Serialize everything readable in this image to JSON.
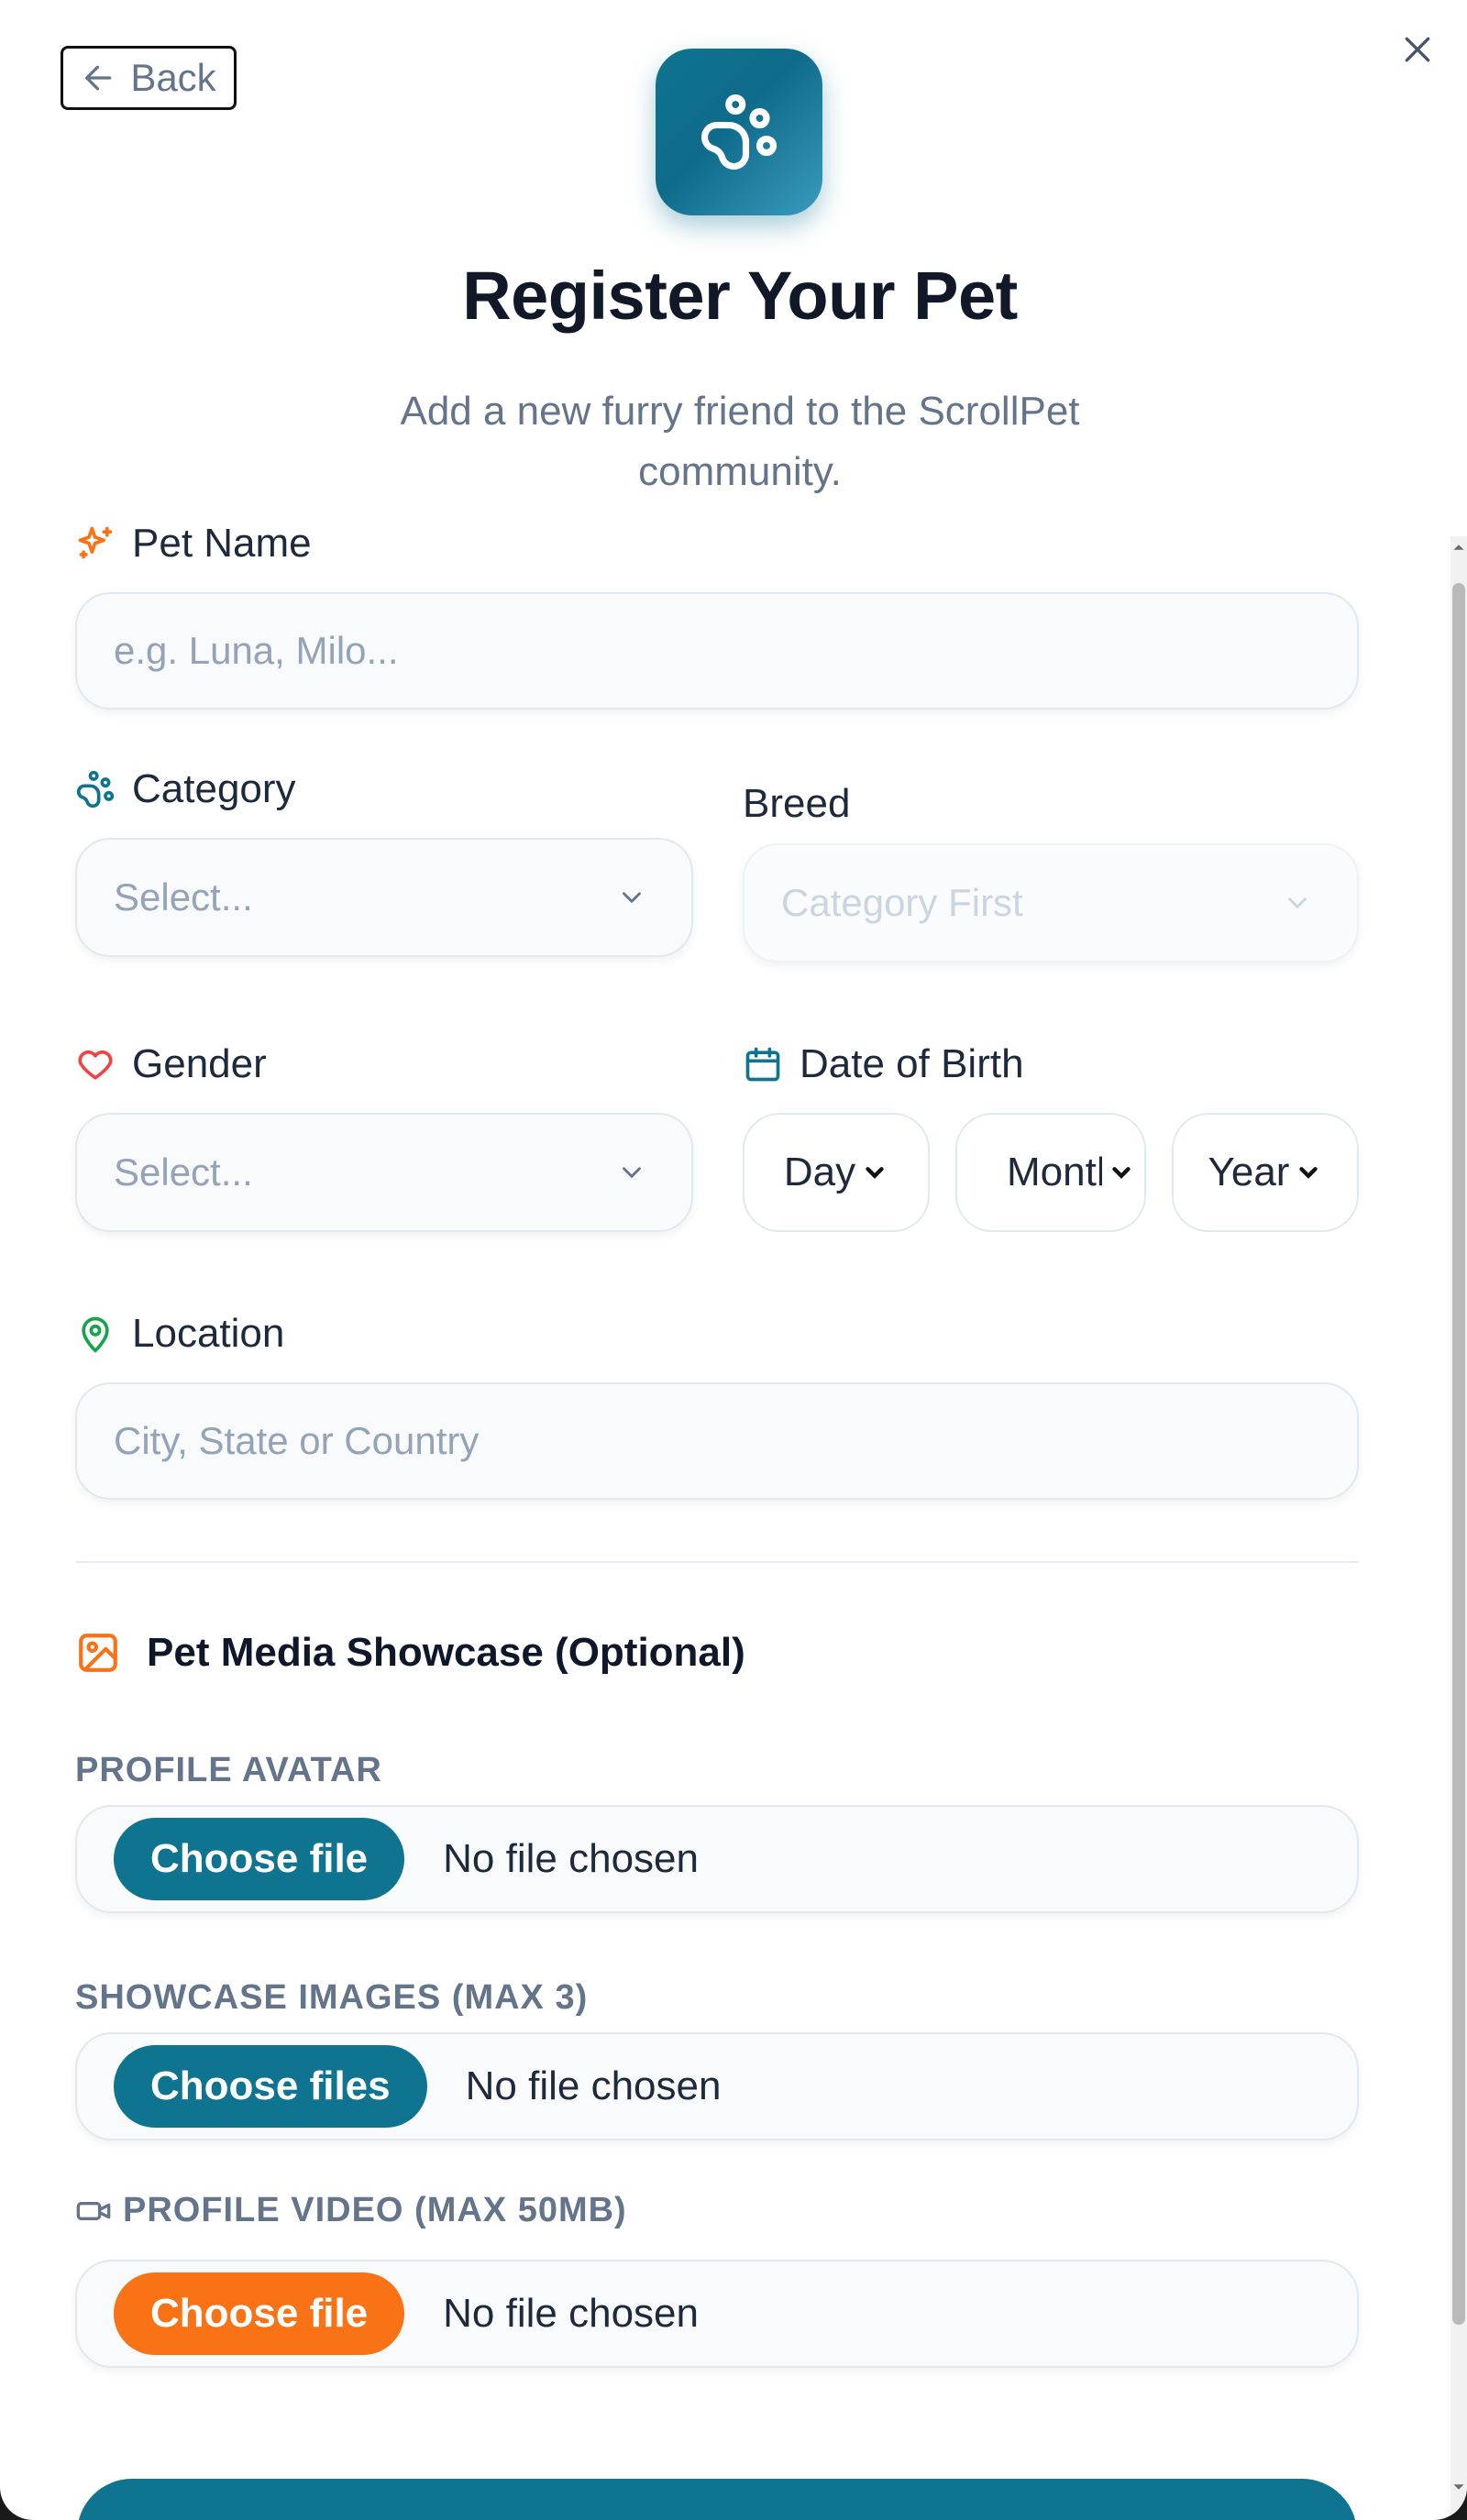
{
  "header": {
    "back_label": "Back",
    "title": "Register Your Pet",
    "subtitle": "Add a new furry friend to the ScrollPet community."
  },
  "form": {
    "pet_name": {
      "label": "Pet Name",
      "placeholder": "e.g. Luna, Milo..."
    },
    "category": {
      "label": "Category",
      "value": "Select..."
    },
    "breed": {
      "label": "Breed",
      "value": "Category First"
    },
    "gender": {
      "label": "Gender",
      "value": "Select..."
    },
    "date_of_birth": {
      "label": "Date of Birth",
      "day": "Day",
      "month": "Month",
      "year": "Year"
    },
    "location": {
      "label": "Location",
      "placeholder": "City, State or Country"
    }
  },
  "media": {
    "section_title": "Pet Media Showcase (Optional)",
    "profile_avatar": {
      "label": "PROFILE AVATAR",
      "button": "Choose file",
      "status": "No file chosen"
    },
    "showcase_images": {
      "label": "SHOWCASE IMAGES (MAX 3)",
      "button": "Choose files",
      "status": "No file chosen"
    },
    "profile_video": {
      "label": "PROFILE VIDEO (MAX 50MB)",
      "button": "Choose file",
      "status": "No file chosen"
    }
  },
  "icons": {
    "logo": "paw-icon",
    "pet_name": "sparkles-icon",
    "category": "paw-icon",
    "gender": "heart-icon",
    "date_of_birth": "calendar-icon",
    "location": "map-pin-icon",
    "media": "image-icon",
    "video": "video-icon",
    "close": "close-icon",
    "back": "arrow-left-icon"
  },
  "colors": {
    "primary": "#0e7490",
    "accent_orange": "#f97316",
    "heart_red": "#ef4444",
    "location_green": "#16a34a",
    "muted_text": "#64748b"
  }
}
